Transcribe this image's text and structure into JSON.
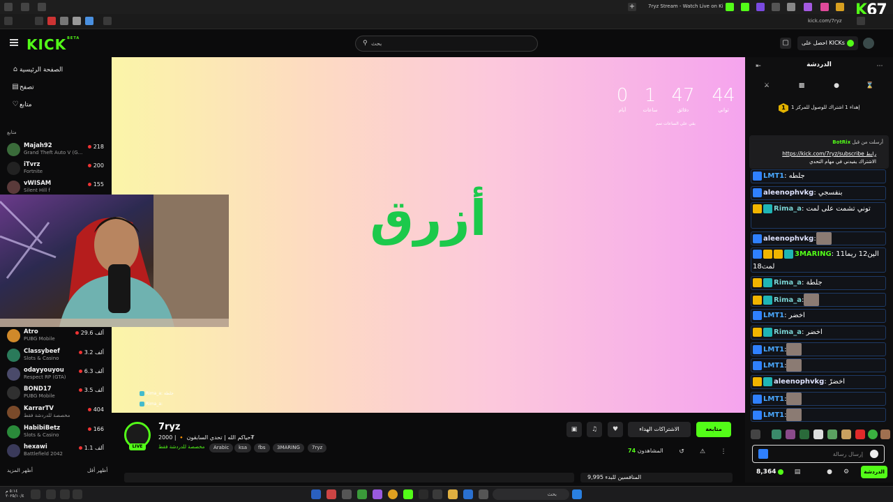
{
  "browser": {
    "tab_title": "7ryz Stream - Watch Live on Ki",
    "url": "kick.com/7ryz",
    "overlay_count": "67"
  },
  "header": {
    "logo": "KICK",
    "logo_badge": "BETA",
    "search_placeholder": "بحث",
    "get_kicks_label": "احصل على KICKs"
  },
  "sidebar": {
    "nav": [
      {
        "label": "الصفحة الرئيسية",
        "icon": "home-icon"
      },
      {
        "label": "تصفح",
        "icon": "browse-icon"
      },
      {
        "label": "متابع",
        "icon": "heart-icon"
      }
    ],
    "section_title": "متابع",
    "channels": [
      {
        "name": "Majah92",
        "game": "Grand Theft Auto V (G...",
        "viewers": "218",
        "color": "#3a6b3a"
      },
      {
        "name": "iTvrz",
        "game": "Fortnite",
        "viewers": "200",
        "color": "#222222"
      },
      {
        "name": "vWISAM",
        "game": "Silent Hill f",
        "viewers": "155",
        "color": "#5a3a3a"
      },
      {
        "name": "Atro",
        "game": "PUBG Mobile",
        "viewers": "29.6 ألف",
        "color": "#d0892a"
      },
      {
        "name": "Classybeef",
        "game": "Slots & Casino",
        "viewers": "3.2 ألف",
        "color": "#2a7a5a"
      },
      {
        "name": "odayyouyou",
        "game": "Respect RP (GTA)",
        "viewers": "6.3 ألف",
        "color": "#4a4a6a"
      },
      {
        "name": "BOND17",
        "game": "PUBG Mobile",
        "viewers": "3.5 ألف",
        "color": "#303030"
      },
      {
        "name": "KarrarTV",
        "game": "مخصصة للدردشة فقط",
        "viewers": "404",
        "color": "#7a4a2a"
      },
      {
        "name": "HabibiBetz",
        "game": "Slots & Casino",
        "viewers": "166",
        "color": "#2a8a3a"
      },
      {
        "name": "hexawi",
        "game": "Battlefield 2042",
        "viewers": "1.1 ألف",
        "color": "#3a3a5a"
      }
    ],
    "show_more": "أظهر المزيد",
    "show_less": "أظهر أقل"
  },
  "video": {
    "big_word": "أزرق",
    "countdown": [
      {
        "value": "44",
        "label": "ثواني"
      },
      {
        "value": "47",
        "label": "دقائق"
      },
      {
        "value": "1",
        "label": "ساعات"
      },
      {
        "value": "0",
        "label": "أيام"
      }
    ],
    "countdown_sub": "بقي على الساعات تمم",
    "mini_chat": [
      "Rima_a: جلطة",
      "Rima_a:"
    ]
  },
  "stream": {
    "name": "7ryz",
    "live": "LIVE",
    "title": "حياكم الله | تحدي السابقون 🔸 | 2000₮",
    "category": "مخصصة للدردشة فقط",
    "tags": [
      "7ryz",
      "3MARING",
      "fbs",
      "ksa",
      "Arabic"
    ],
    "follow_label": "متابعة",
    "gift_label": "الاشتراكات الهداء",
    "viewers_count": "74",
    "viewers_label": "المشاهدون",
    "under_text": "المنافسين للبدء 9,995"
  },
  "chat": {
    "title": "الدردشة",
    "goal_number": "1",
    "goal_text": "إهداء 1 اشتراك للوصول للمركز 1",
    "pinned_by": "أرسلت من قبل",
    "pinned_user": "BotRix",
    "pinned_link": "https://kick.com/7ryz/subscribe رابط",
    "pinned_text": "الاشتراك يفيدني في مهام التحدي",
    "messages": [
      {
        "user": "LMT1",
        "text": ": جلطه",
        "ucls": "u-blue",
        "badges": [
          "b-blue"
        ]
      },
      {
        "user": "aleenophvkg",
        "text": ": بنفسجي",
        "ucls": "u-white",
        "badges": [
          "b-blue"
        ]
      },
      {
        "user": "Rima_a",
        "text": ": توني تشمت على لمت",
        "ucls": "u-teal",
        "badges": [
          "b-crown",
          "b-teal"
        ]
      },
      {
        "user": "aleenophvkg",
        "text": ":",
        "ucls": "u-white",
        "badges": [
          "b-blue"
        ]
      },
      {
        "user": "3MARING",
        "text": ": الين12 ريما11 لمت18",
        "ucls": "u-green",
        "badges": [
          "b-blue",
          "b-crown",
          "b-crown",
          "b-teal"
        ]
      },
      {
        "user": "Rima_a",
        "text": ": جلطة",
        "ucls": "u-teal",
        "badges": [
          "b-crown",
          "b-teal"
        ]
      },
      {
        "user": "Rima_a",
        "text": ":",
        "ucls": "u-teal",
        "badges": [
          "b-crown",
          "b-teal"
        ]
      },
      {
        "user": "LMT1",
        "text": ": اخضر",
        "ucls": "u-blue",
        "badges": [
          "b-blue"
        ]
      },
      {
        "user": "Rima_a",
        "text": ": اخضر",
        "ucls": "u-teal",
        "badges": [
          "b-crown",
          "b-teal"
        ]
      },
      {
        "user": "LMT1",
        "text": ":",
        "ucls": "u-blue",
        "badges": [
          "b-blue"
        ]
      },
      {
        "user": "LMT1",
        "text": ":",
        "ucls": "u-blue",
        "badges": [
          "b-blue"
        ]
      },
      {
        "user": "aleenophvkg",
        "text": ": اخضرً",
        "ucls": "u-white",
        "badges": [
          "b-crown",
          "b-teal"
        ]
      },
      {
        "user": "LMT1",
        "text": ":",
        "ucls": "u-blue",
        "badges": [
          "b-blue"
        ]
      },
      {
        "user": "LMT1",
        "text": ":",
        "ucls": "u-blue",
        "badges": [
          "b-blue"
        ]
      }
    ],
    "input_placeholder": "إرسال رسالة",
    "kicks_balance": "8,364",
    "send_label": "الدردشة"
  },
  "taskbar": {
    "search_placeholder": "بحث",
    "time": "٥:١٤ م",
    "date": "٢٠٢٥/١٠/٤"
  }
}
